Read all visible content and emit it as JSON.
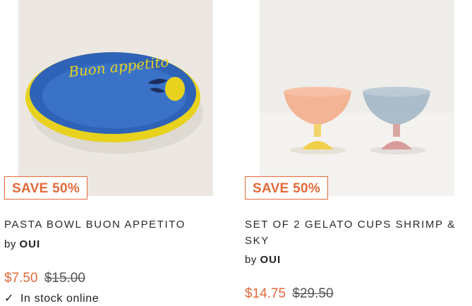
{
  "products": [
    {
      "badge": "SAVE 50%",
      "title": "PASTA BOWL BUON APPETITO",
      "by": "by",
      "brand": "OUI",
      "sale_price": "$7.50",
      "original_price": "$15.00",
      "stock": "In stock online",
      "bowl_text": "Buon appetito",
      "accent": "#e26a3b"
    },
    {
      "badge": "SAVE 50%",
      "title": "SET OF 2 GELATO CUPS SHRIMP & SKY",
      "by": "by",
      "brand": "OUI",
      "sale_price": "$14.75",
      "original_price": "$29.50",
      "accent": "#e26a3b"
    }
  ]
}
